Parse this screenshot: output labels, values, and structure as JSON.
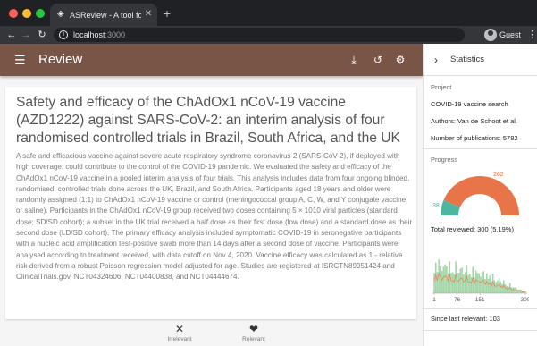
{
  "browser": {
    "tab_title": "ASReview - A tool for AI-assist",
    "url_host": "localhost",
    "url_port": ":3000",
    "profile_label": "Guest"
  },
  "app": {
    "title": "Review",
    "icons": [
      "download-icon",
      "history-icon",
      "settings-icon"
    ]
  },
  "paper": {
    "title": "Safety and efficacy of the ChAdOx1 nCoV-19 vaccine (AZD1222) against SARS-CoV-2: an interim analysis of four randomised controlled trials in Brazil, South Africa, and the UK",
    "abstract": "A safe and efficacious vaccine against severe acute respiratory syndrome coronavirus 2 (SARS-CoV-2), if deployed with high coverage, could contribute to the control of the COVID-19 pandemic. We evaluated the safety and efficacy of the ChAdOx1 nCoV-19 vaccine in a pooled interim analysis of four trials. This analysis includes data from four ongoing blinded, randomised, controlled trials done across the UK, Brazil, and South Africa. Participants aged 18 years and older were randomly assigned (1:1) to ChAdOx1 nCoV-19 vaccine or control (meningococcal group A, C, W, and Y conjugate vaccine or saline). Participants in the ChAdOx1 nCoV-19 group received two doses containing 5 × 1010 viral particles (standard dose; SD/SD cohort); a subset in the UK trial received a half dose as their first dose (low dose) and a standard dose as their second dose (LD/SD cohort). The primary efficacy analysis included symptomatic COVID-19 in seronegative participants with a nucleic acid amplification test-positive swab more than 14 days after a second dose of vaccine. Participants were analysed according to treatment received, with data cutoff on Nov 4, 2020. Vaccine efficacy was calculated as 1 - relative risk derived from a robust Poisson regression model adjusted for age. Studies are registered at ISRCTN89951424 and ClinicalTrials.gov, NCT04324606, NCT04400838, and NCT04444674."
  },
  "actions": {
    "irrelevant": "Irrelevant",
    "relevant": "Relevant"
  },
  "statistics": {
    "title": "Statistics",
    "project_label": "Project",
    "project_name": "COVID-19 vaccine search",
    "authors": "Authors: Van de Schoot et al.",
    "num_publications": "Number of publications: 5782",
    "progress_label": "Progress",
    "gauge": {
      "irrelevant_count": "262",
      "relevant_count": "38",
      "irrelevant_value": 262,
      "relevant_value": 38,
      "irrelevant_color": "#e8744a",
      "relevant_color": "#4db6a0"
    },
    "total_reviewed": "Total reviewed: 300 (5.19%)",
    "histogram": {
      "x_ticks": [
        "1",
        "76",
        "151",
        "300"
      ],
      "tick_values": [
        1,
        76,
        151,
        300
      ],
      "x_max": 300,
      "bar_color": "#a5d6a7",
      "line_color": "#e8744a"
    },
    "since_last_relevant": "Since last relevant: 103"
  }
}
